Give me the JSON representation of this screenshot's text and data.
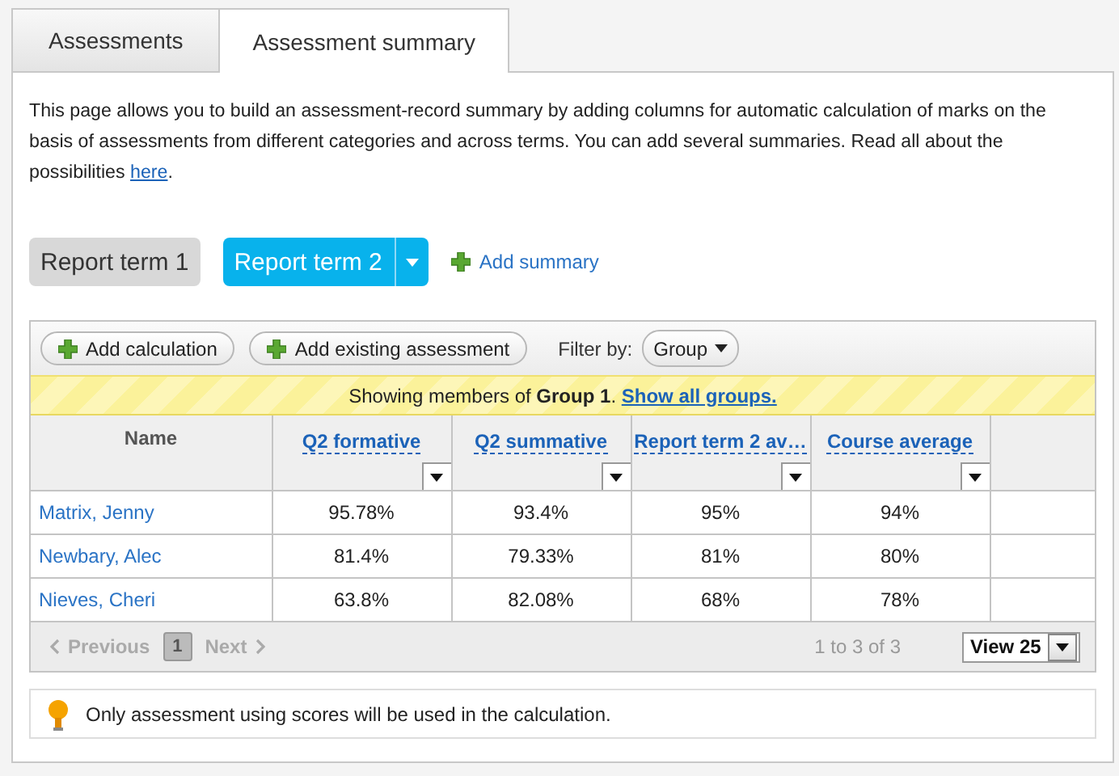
{
  "tabs": [
    {
      "label": "Assessments",
      "selected": false
    },
    {
      "label": "Assessment summary",
      "selected": true
    }
  ],
  "intro": {
    "text": "This page allows you to build an assessment-record summary by adding columns for automatic calculation of marks on the basis of assessments from different categories and across terms. You can add several summaries. Read all about the possibilities ",
    "link": "here",
    "end": "."
  },
  "summaries": [
    {
      "label": "Report term 1",
      "selected": false
    },
    {
      "label": "Report term 2",
      "selected": true
    }
  ],
  "add_summary": "Add summary",
  "toolbar": {
    "buttons": [
      "Add calculation",
      "Add existing assessment"
    ],
    "filter_label": "Filter by:",
    "filter_value": "Group"
  },
  "banner": {
    "text": "Showing members of **Group 1**.",
    "link": "Show all groups."
  },
  "table": {
    "columns": [
      "Name",
      "Q2 formative",
      "Q2 summative",
      "Report term 2 av…",
      "Course average"
    ],
    "rows": [
      [
        "Matrix, Jenny",
        "95.78%",
        "93.4%",
        "95%",
        "94%"
      ],
      [
        "Newbary, Alec",
        "81.4%",
        "79.33%",
        "81%",
        "80%"
      ],
      [
        "Nieves, Cheri",
        "63.8%",
        "82.08%",
        "68%",
        "78%"
      ]
    ]
  },
  "pager": {
    "previous": {
      "label": "Previous",
      "disabled": true
    },
    "pages": [
      {
        "label": "1",
        "selected": true
      }
    ],
    "next": {
      "label": "Next",
      "disabled": true
    },
    "range": "1 to 3 of 3",
    "view": "View 25"
  },
  "tip": "Only assessment using scores will be used in the calculation."
}
